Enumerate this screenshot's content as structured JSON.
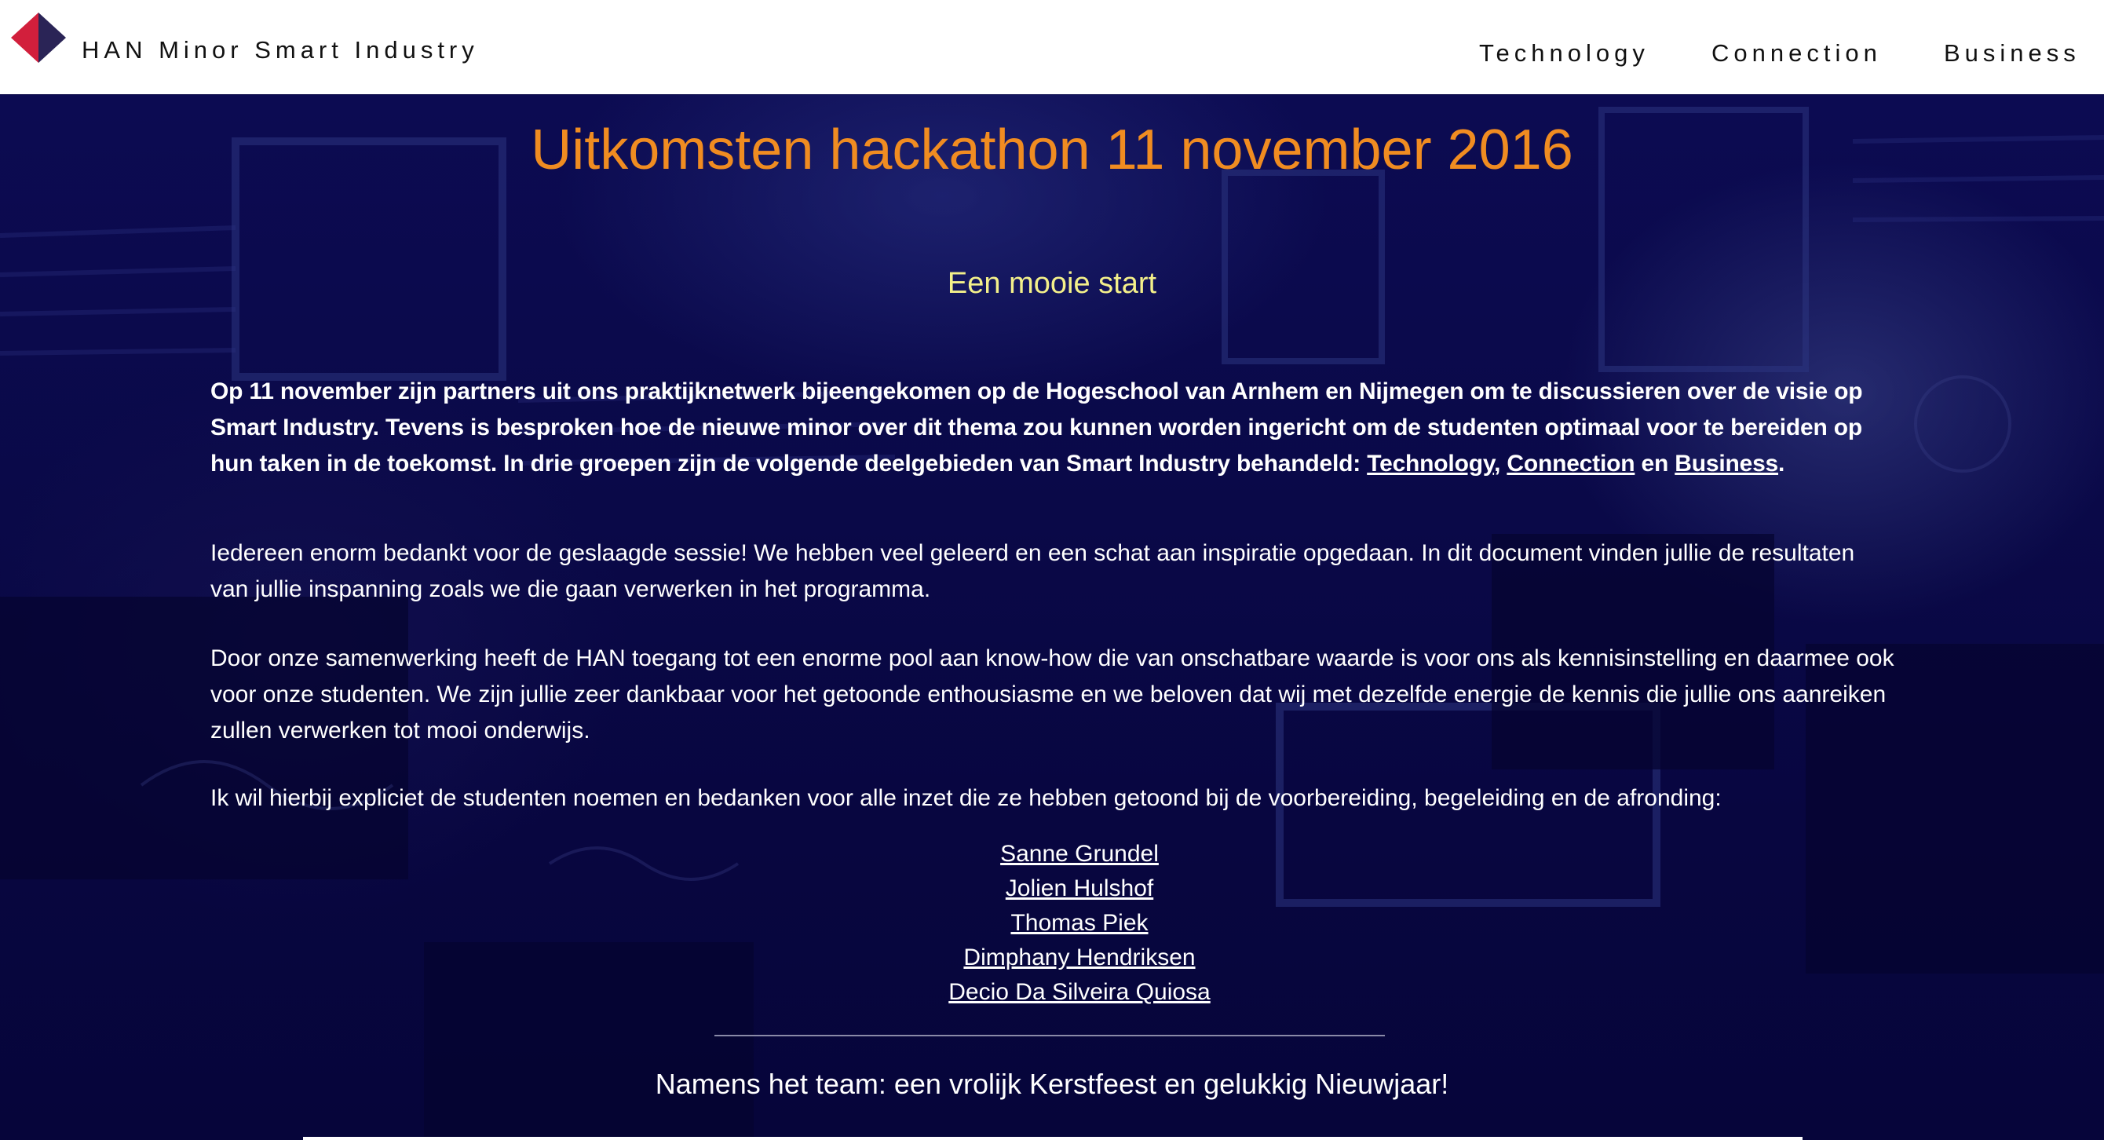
{
  "header": {
    "brand": "HAN Minor Smart Industry",
    "nav": {
      "technology": "Technology",
      "connection": "Connection",
      "business": "Business"
    },
    "logo_colors": {
      "left": "#d21f3c",
      "right": "#2a2456"
    }
  },
  "main": {
    "title": "Uitkomsten hackathon 11 november 2016",
    "subtitle": "Een mooie start",
    "p1": {
      "text": "Op 11 november zijn partners uit ons praktijknetwerk bijeengekomen op de Hogeschool van Arnhem en Nijmegen om te discussieren over de visie op Smart Industry. Tevens is besproken hoe de nieuwe minor over dit thema zou kunnen worden ingericht om de studenten optimaal voor te bereiden op hun taken in de toekomst. In drie groepen zijn de volgende deelgebieden van Smart Industry behandeld: ",
      "link_technology": "Technology",
      "sep1": ", ",
      "link_connection": "Connection",
      "sep2": " en ",
      "link_business": "Business",
      "end": "."
    },
    "p2": "Iedereen enorm bedankt voor de geslaagde sessie! We hebben veel geleerd en een schat aan inspiratie opgedaan. In dit document vinden jullie de resultaten van jullie inspanning zoals we die gaan verwerken in het programma.",
    "p3": "Door onze samenwerking heeft de HAN toegang tot een enorme pool aan know-how die van onschatbare waarde is voor ons als kennisinstelling en daarmee ook voor onze studenten. We zijn jullie zeer dankbaar voor het getoonde enthousiasme en we beloven dat wij met dezelfde energie de kennis die jullie ons aanreiken zullen verwerken tot mooi onderwijs.",
    "p4": "Ik wil hierbij expliciet de studenten noemen en bedanken voor alle inzet die ze hebben getoond bij de voorbereiding, begeleiding en de afronding:",
    "students": [
      "Sanne Grundel",
      "Jolien Hulshof",
      "Thomas Piek",
      "Dimphany Hendriksen",
      "Decio Da Silveira Quiosa"
    ],
    "closing": "Namens het team: een vrolijk Kerstfeest en gelukkig Nieuwjaar!"
  },
  "colors": {
    "title": "#f08c21",
    "subtitle": "#f4f08a",
    "background": "#0a0948"
  }
}
